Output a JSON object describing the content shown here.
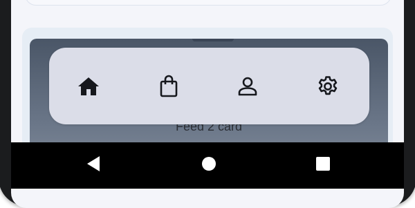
{
  "feed": {
    "card_label": "Feed 2 card"
  },
  "bottom_nav": {
    "items": [
      {
        "id": "home",
        "icon": "home-icon"
      },
      {
        "id": "shop",
        "icon": "shopping-bag-icon"
      },
      {
        "id": "profile",
        "icon": "person-icon"
      },
      {
        "id": "settings",
        "icon": "gear-icon"
      }
    ]
  },
  "system_nav": {
    "buttons": [
      {
        "id": "back",
        "icon": "back-triangle-icon"
      },
      {
        "id": "home",
        "icon": "home-circle-icon"
      },
      {
        "id": "recents",
        "icon": "recents-square-icon"
      }
    ]
  },
  "colors": {
    "nav_background": "#dbdde8",
    "icon": "#16181d",
    "system_bar": "#000000",
    "card_gradient_top": "#4a5667"
  }
}
